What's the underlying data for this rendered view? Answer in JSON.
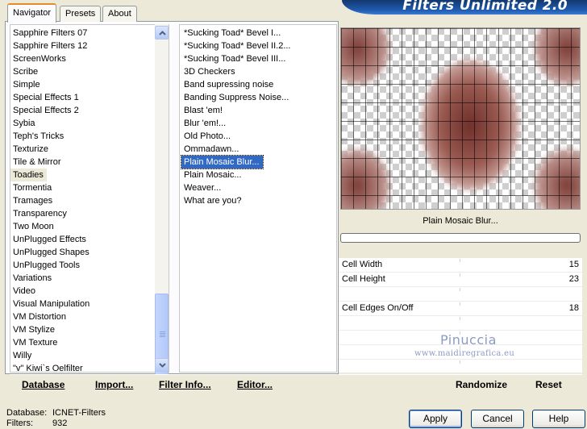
{
  "window": {
    "banner_title": "Filters Unlimited 2.0"
  },
  "tabs": [
    {
      "label": "Navigator",
      "active": true
    },
    {
      "label": "Presets",
      "active": false
    },
    {
      "label": "About",
      "active": false
    }
  ],
  "categories": {
    "highlighted": "Toadies",
    "items": [
      "Sapphire Filters 07",
      "Sapphire Filters 12",
      "ScreenWorks",
      "Scribe",
      "Simple",
      "Special Effects 1",
      "Special Effects 2",
      "Sybia",
      "Teph's Tricks",
      "Texturize",
      "Tile & Mirror",
      "Toadies",
      "Tormentia",
      "Tramages",
      "Transparency",
      "Two Moon",
      "UnPlugged Effects",
      "UnPlugged Shapes",
      "UnPlugged Tools",
      "Variations",
      "Video",
      "Visual Manipulation",
      "VM Distortion",
      "VM Stylize",
      "VM Texture",
      "Willy",
      "\"v\" Kiwi`s Oelfilter"
    ]
  },
  "filters": {
    "selected": "Plain Mosaic Blur...",
    "items": [
      "*Sucking Toad*  Bevel I...",
      "*Sucking Toad*  Bevel II.2...",
      "*Sucking Toad*  Bevel III...",
      "3D Checkers",
      "Band supressing noise",
      "Banding Suppress Noise...",
      "Blast 'em!",
      "Blur 'em!...",
      "Old Photo...",
      "Ommadawn...",
      "Plain Mosaic Blur...",
      "Plain Mosaic...",
      "Weaver...",
      "What are you?"
    ]
  },
  "left_buttons": {
    "database": "Database",
    "import": "Import...",
    "filter_info": "Filter Info...",
    "editor": "Editor..."
  },
  "right_buttons": {
    "randomize": "Randomize",
    "reset": "Reset"
  },
  "preview": {
    "filter_name": "Plain Mosaic Blur...",
    "progress": 0
  },
  "params": [
    {
      "label": "Cell Width",
      "value": "15"
    },
    {
      "label": "Cell Height",
      "value": "23"
    },
    {
      "label": "",
      "value": ""
    },
    {
      "label": "Cell Edges On/Off",
      "value": "18"
    },
    {
      "label": "",
      "value": ""
    },
    {
      "label": "",
      "value": ""
    },
    {
      "label": "",
      "value": ""
    },
    {
      "label": "",
      "value": ""
    }
  ],
  "watermark": {
    "name": "Pinuccia",
    "url": "www.maidiregrafica.eu"
  },
  "status": {
    "database_label": "Database:",
    "database_value": "ICNET-Filters",
    "filters_label": "Filters:",
    "filters_value": "932"
  },
  "dialog_buttons": {
    "apply": "Apply",
    "cancel": "Cancel",
    "help": "Help"
  },
  "colors": {
    "selection": "#316ac5",
    "banner": "#1f5bb0",
    "face": "#ece9d8",
    "tab_accent": "#e68b2c",
    "mosaic_brown": "#7a3b34"
  }
}
